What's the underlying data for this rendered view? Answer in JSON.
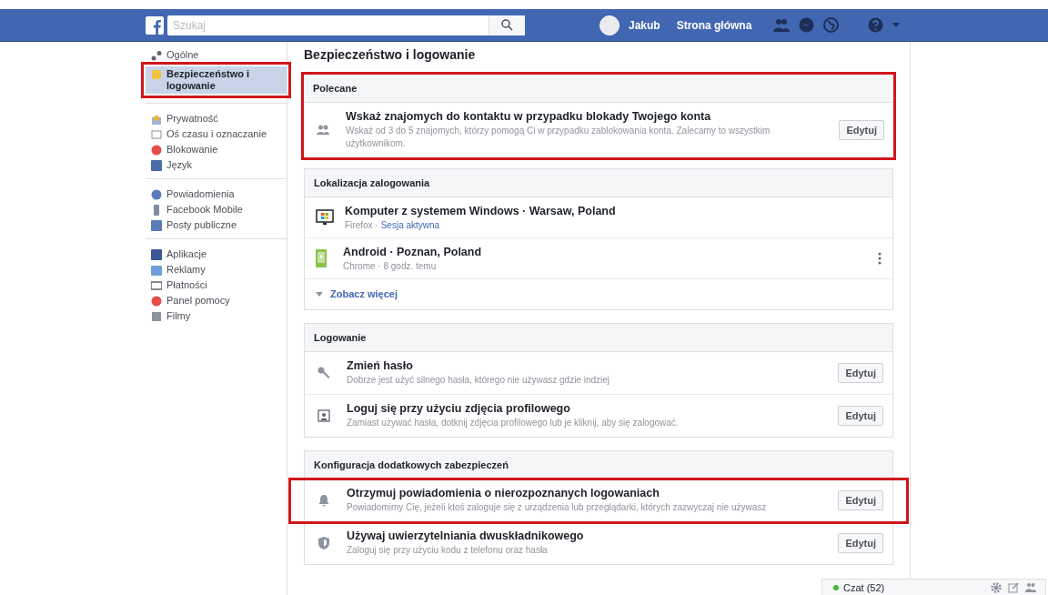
{
  "topbar": {
    "search": {
      "placeholder": "Szukaj"
    },
    "user": "Jakub",
    "home": "Strona główna"
  },
  "sidebar": {
    "groups": [
      [
        {
          "label": "Ogólne",
          "selected": false,
          "highlighted": false
        },
        {
          "label": "Bezpieczeństwo i logowanie",
          "selected": true,
          "highlighted": true
        }
      ],
      [
        {
          "label": "Prywatność",
          "selected": false,
          "highlighted": false
        },
        {
          "label": "Oś czasu i oznaczanie",
          "selected": false,
          "highlighted": false
        },
        {
          "label": "Blokowanie",
          "selected": false,
          "highlighted": false
        },
        {
          "label": "Język",
          "selected": false,
          "highlighted": false
        }
      ],
      [
        {
          "label": "Powiadomienia",
          "selected": false,
          "highlighted": false
        },
        {
          "label": "Facebook Mobile",
          "selected": false,
          "highlighted": false
        },
        {
          "label": "Posty publiczne",
          "selected": false,
          "highlighted": false
        }
      ],
      [
        {
          "label": "Aplikacje",
          "selected": false,
          "highlighted": false
        },
        {
          "label": "Reklamy",
          "selected": false,
          "highlighted": false
        },
        {
          "label": "Płatności",
          "selected": false,
          "highlighted": false
        },
        {
          "label": "Panel pomocy",
          "selected": false,
          "highlighted": false
        },
        {
          "label": "Filmy",
          "selected": false,
          "highlighted": false
        }
      ]
    ]
  },
  "page_title": "Bezpieczeństwo i logowanie",
  "sections": [
    {
      "title": "Polecane",
      "highlighted": true,
      "rows": [
        {
          "kind": "setting",
          "title": "Wskaż znajomych do kontaktu w przypadku blokady Twojego konta",
          "description": "Wskaż od 3 do 5 znajomych, którzy pomogą Ci w przypadku zablokowania konta. Zalecamy to wszystkim użytkownikom.",
          "button": "Edytuj",
          "highlighted": false
        }
      ]
    },
    {
      "title": "Lokalizacja zalogowania",
      "highlighted": false,
      "more": "Zobacz więcej",
      "rows": [
        {
          "kind": "session",
          "title": "Komputer z systemem Windows · Warsaw, Poland",
          "meta": "Firefox ·",
          "status": "Sesja aktywna",
          "menu": false
        },
        {
          "kind": "session",
          "title": "Android · Poznan, Poland",
          "meta": "Chrome · 8 godz. temu",
          "menu": true
        }
      ]
    },
    {
      "title": "Logowanie",
      "highlighted": false,
      "rows": [
        {
          "kind": "setting",
          "title": "Zmień hasło",
          "description": "Dobrze jest użyć silnego hasła, którego nie używasz gdzie indziej",
          "button": "Edytuj",
          "highlighted": false
        },
        {
          "kind": "setting",
          "title": "Loguj się przy użyciu zdjęcia profilowego",
          "description": "Zamiast używać hasła, dotknij zdjęcia profilowego lub je kliknij, aby się zalogować.",
          "button": "Edytuj",
          "highlighted": false
        }
      ]
    },
    {
      "title": "Konfiguracja dodatkowych zabezpieczeń",
      "highlighted": false,
      "rows": [
        {
          "kind": "setting",
          "title": "Otrzymuj powiadomienia o nierozpoznanych logowaniach",
          "description": "Powiadomimy Cię, jeżeli ktoś zaloguje się z urządzenia lub przeglądarki, których zazwyczaj nie używasz",
          "button": "Edytuj",
          "highlighted": true
        },
        {
          "kind": "setting",
          "title": "Używaj uwierzytelniania dwuskładnikowego",
          "description": "Zaloguj się przy użyciu kodu z telefonu oraz hasła",
          "button": "Edytuj",
          "highlighted": false
        }
      ]
    }
  ],
  "chat": {
    "label": "Czat (52)",
    "online": true
  }
}
